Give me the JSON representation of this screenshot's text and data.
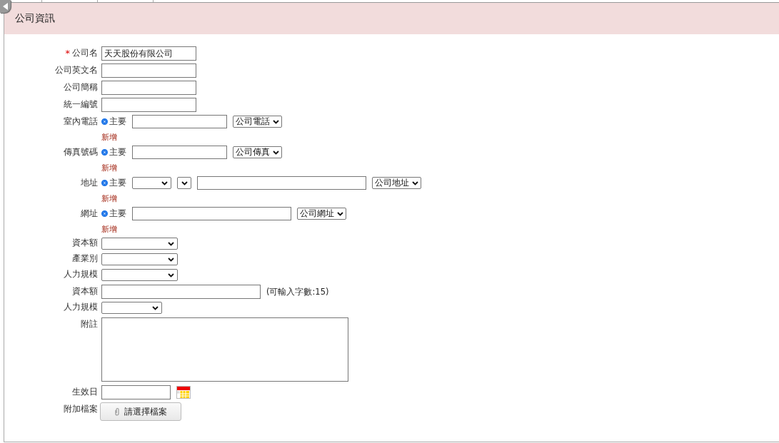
{
  "section": {
    "title": "公司資訊"
  },
  "fields": [
    {
      "kind": "text",
      "label": "公司名",
      "required_mark": "*",
      "value": "天天股份有限公司"
    },
    {
      "kind": "text",
      "label": "公司英文名"
    },
    {
      "kind": "text",
      "label": "公司簡稱"
    },
    {
      "kind": "text",
      "label": "統一編號"
    },
    {
      "kind": "phone",
      "label": "室內電話",
      "radio": {
        "label": "主要",
        "selected": true
      },
      "type_select": "公司電話",
      "add_link": "新增"
    },
    {
      "kind": "phone",
      "label": "傳真號碼",
      "radio": {
        "label": "主要",
        "selected": true
      },
      "type_select": "公司傳真",
      "add_link": "新增"
    },
    {
      "kind": "address",
      "label": "地址",
      "radio": {
        "label": "主要",
        "selected": true
      },
      "type_select": "公司地址",
      "add_link": "新增"
    },
    {
      "kind": "url",
      "label": "網址",
      "radio": {
        "label": "主要",
        "selected": true
      },
      "type_select": "公司網址",
      "add_link": "新增"
    },
    {
      "kind": "select",
      "label": "資本額"
    },
    {
      "kind": "select",
      "label": "產業別"
    },
    {
      "kind": "select",
      "label": "人力規模"
    },
    {
      "kind": "text-wide",
      "label": "資本額",
      "hint": "(可輸入字數:15)"
    },
    {
      "kind": "select-short",
      "label": "人力規模"
    },
    {
      "kind": "textarea",
      "label": "附註"
    },
    {
      "kind": "date",
      "label": "生效日"
    },
    {
      "kind": "file",
      "label": "附加檔案",
      "button": "請選擇檔案"
    }
  ]
}
